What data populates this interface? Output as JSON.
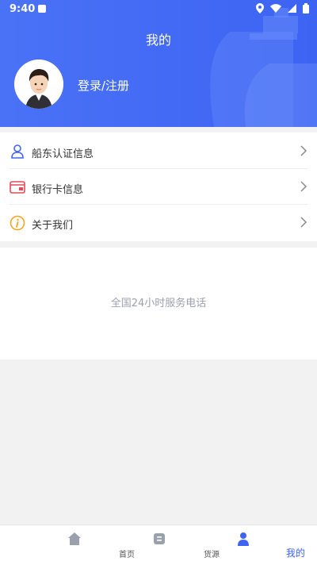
{
  "status_bar": {
    "time": "9:40"
  },
  "header": {
    "title": "我的",
    "login_text": "登录/注册"
  },
  "menu": {
    "items": [
      {
        "label": "船东认证信息",
        "icon": "user-icon"
      },
      {
        "label": "银行卡信息",
        "icon": "card-icon"
      },
      {
        "label": "关于我们",
        "icon": "info-icon"
      }
    ]
  },
  "service": {
    "text": "全国24小时服务电话"
  },
  "tabbar": {
    "tabs": [
      {
        "label": "首页",
        "icon": "home-icon"
      },
      {
        "label": "货源",
        "icon": "cargo-icon"
      },
      {
        "label": "我的",
        "icon": "profile-icon",
        "active": true
      }
    ]
  },
  "colors": {
    "accent": "#3d63f3",
    "card_icon": "#e64a5a",
    "info_icon": "#f5a623"
  }
}
